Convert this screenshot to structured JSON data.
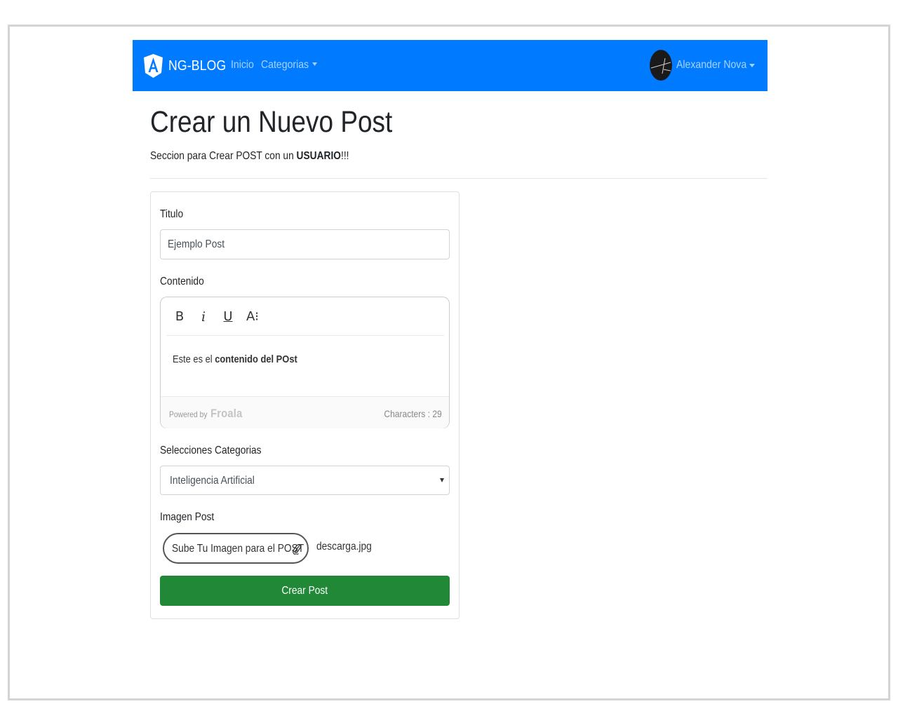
{
  "navbar": {
    "brand": "NG-BLOG",
    "links": [
      {
        "label": "Inicio"
      },
      {
        "label": "Categorias",
        "dropdown": true
      }
    ],
    "user_name": "Alexander Nova",
    "color": "#007bff"
  },
  "page": {
    "title": "Crear un Nuevo Post",
    "lead_prefix": "Seccion para Crear POST con un ",
    "lead_bold": "USUARIO",
    "lead_suffix": "!!!"
  },
  "form": {
    "title_label": "Titulo",
    "title_value": "Ejemplo Post",
    "content_label": "Contenido",
    "editor": {
      "toolbar": [
        {
          "name": "bold",
          "glyph": "B"
        },
        {
          "name": "italic",
          "glyph": "i"
        },
        {
          "name": "underline",
          "glyph": "U"
        },
        {
          "name": "font-size",
          "glyph": "A⁝"
        }
      ],
      "content_prefix": "Este es el ",
      "content_bold": "contenido del POst",
      "powered_by": "Powered by",
      "powered_brand": "Froala",
      "char_count": "Characters : 29"
    },
    "category_label": "Selecciones Categorias",
    "category_value": "Inteligencia Artificial",
    "image_label": "Imagen Post",
    "upload_button": "Sube Tu Imagen para el POST",
    "file_name": "descarga.jpg",
    "submit_label": "Crear Post",
    "submit_color": "#218838"
  }
}
